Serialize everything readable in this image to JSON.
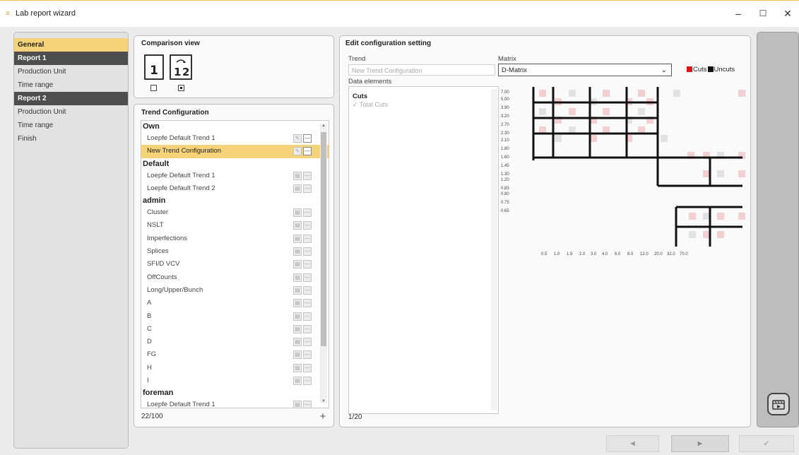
{
  "window": {
    "title": "Lab report wizard",
    "app_icon": "app-icon"
  },
  "nav": {
    "items": [
      {
        "label": "General",
        "kind": "active"
      },
      {
        "label": "Report 1",
        "kind": "section"
      },
      {
        "label": "Production Unit",
        "kind": "item"
      },
      {
        "label": "Time range",
        "kind": "item"
      },
      {
        "label": "Report 2",
        "kind": "section"
      },
      {
        "label": "Production Unit",
        "kind": "item"
      },
      {
        "label": "Time range",
        "kind": "item"
      },
      {
        "label": "Finish",
        "kind": "item"
      }
    ]
  },
  "comparison": {
    "title": "Comparison view",
    "icons": [
      {
        "label": "1",
        "checked": false
      },
      {
        "label": "1↔2",
        "checked": true
      }
    ]
  },
  "trend": {
    "title": "Trend Configuration",
    "groups": [
      {
        "name": "Own",
        "items": [
          {
            "label": "Loepfe Default Trend 1",
            "selected": false
          },
          {
            "label": "New Trend Configuration",
            "selected": true
          }
        ]
      },
      {
        "name": "Default",
        "items": [
          {
            "label": "Loepfe Default Trend 1",
            "selected": false
          },
          {
            "label": "Loepfe Default Trend 2",
            "selected": false
          }
        ]
      },
      {
        "name": "admin",
        "items": [
          {
            "label": "Cluster"
          },
          {
            "label": "NSLT"
          },
          {
            "label": "Imperfections"
          },
          {
            "label": "Splices"
          },
          {
            "label": "SFI/D VCV"
          },
          {
            "label": "OffCounts"
          },
          {
            "label": "Long/Upper/Bunch"
          },
          {
            "label": "A"
          },
          {
            "label": "B"
          },
          {
            "label": "C"
          },
          {
            "label": "D"
          },
          {
            "label": "FG"
          },
          {
            "label": "H"
          },
          {
            "label": "I"
          }
        ]
      },
      {
        "name": "foreman",
        "items": [
          {
            "label": "Loepfe Default Trend 1"
          }
        ]
      }
    ],
    "count": "22/100",
    "add_label": "+"
  },
  "edit": {
    "title": "Edit configuration setting",
    "trend_label": "Trend",
    "trend_value": "New Trend Configuration",
    "matrix_label": "Matrix",
    "matrix_value": "D-Matrix",
    "legend": {
      "cuts": "Cuts",
      "uncuts": "Uncuts",
      "cuts_color": "#d9151b",
      "uncuts_color": "#111111"
    },
    "data_elements_label": "Data elements",
    "data_group": "Cuts",
    "data_item": "✓ Total Cuts",
    "count": "1/20",
    "matrix": {
      "y_labels": [
        "7.00",
        "5.00",
        "3.90",
        "3.20",
        "2.70",
        "2.30",
        "2.10",
        "1.80",
        "1.60",
        "1.45",
        "1.30",
        "1.20",
        "0.83",
        "0.80",
        "0.75",
        "0.65"
      ],
      "x_labels": [
        "0.5",
        "1.0",
        "1.5",
        "2.0",
        "3.0",
        "4.0",
        "6.0",
        "8.0",
        "12.0",
        "20.0",
        "32.0",
        "70.0"
      ]
    }
  },
  "footer": {
    "back": "◄",
    "next": "►",
    "finish": "✓"
  }
}
